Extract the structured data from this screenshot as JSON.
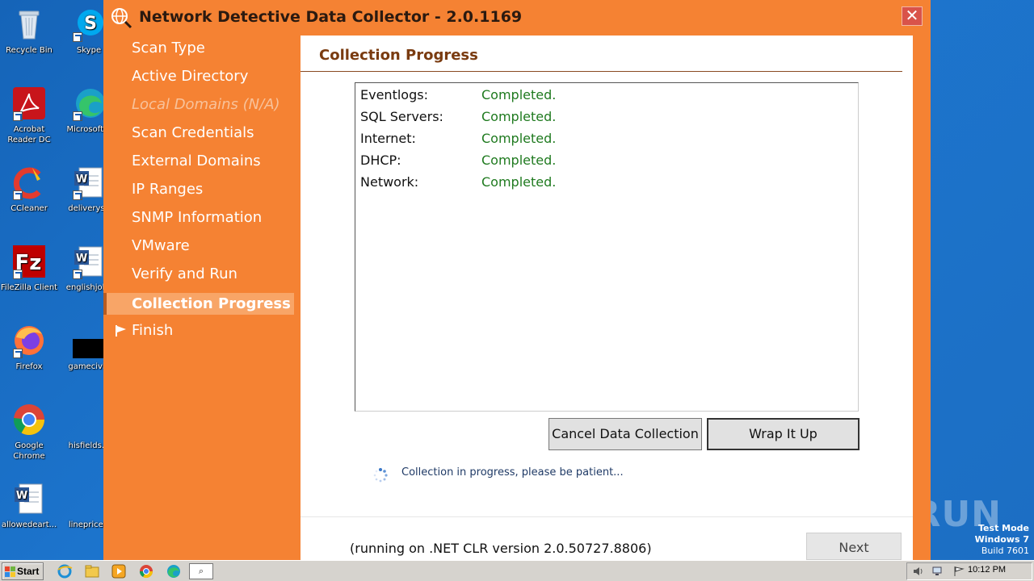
{
  "desktop": {
    "icons": [
      {
        "label": "Recycle Bin"
      },
      {
        "label": "Skype"
      },
      {
        "label": "Acrobat Reader DC"
      },
      {
        "label": "Microsoft E"
      },
      {
        "label": "CCleaner"
      },
      {
        "label": "deliveryse"
      },
      {
        "label": "FileZilla Client"
      },
      {
        "label": "englishjobs"
      },
      {
        "label": "Firefox"
      },
      {
        "label": "gamecivil."
      },
      {
        "label": "Google Chrome"
      },
      {
        "label": "hisfields.p"
      },
      {
        "label": "allowedeart..."
      },
      {
        "label": "lineprice.r"
      }
    ],
    "watermark": "ANY.RUN",
    "test_mode": {
      "line1": "Test Mode",
      "line2": "Windows 7",
      "line3": "Build 7601"
    }
  },
  "window": {
    "title": "Network Detective Data Collector - 2.0.1169",
    "close_glyph": "✕"
  },
  "nav": {
    "items": [
      {
        "label": "Scan Type",
        "state": "normal"
      },
      {
        "label": "Active Directory",
        "state": "normal"
      },
      {
        "label": "Local Domains (N/A)",
        "state": "disabled"
      },
      {
        "label": "Scan Credentials",
        "state": "normal"
      },
      {
        "label": "External Domains",
        "state": "normal"
      },
      {
        "label": "IP Ranges",
        "state": "normal"
      },
      {
        "label": "SNMP Information",
        "state": "normal"
      },
      {
        "label": "VMware",
        "state": "normal"
      },
      {
        "label": "Verify and Run",
        "state": "normal"
      },
      {
        "label": "Collection Progress",
        "state": "active"
      },
      {
        "label": "Finish",
        "state": "normal",
        "icon": "flag-icon"
      }
    ]
  },
  "main": {
    "title": "Collection Progress",
    "status": [
      {
        "name": "Eventlogs:",
        "value": "Completed."
      },
      {
        "name": "SQL Servers:",
        "value": "Completed."
      },
      {
        "name": "Internet:",
        "value": "Completed."
      },
      {
        "name": "DHCP:",
        "value": "Completed."
      },
      {
        "name": "Network:",
        "value": "Completed."
      }
    ],
    "cancel_label": "Cancel Data Collection",
    "wrap_label": "Wrap It Up",
    "progress_message": "Collection in progress, please be patient...",
    "footer_text": "(running on .NET CLR version 2.0.50727.8806)",
    "next_label": "Next"
  },
  "taskbar": {
    "start_label": "Start",
    "search_glyph": "⌕",
    "clock": "10:12 PM"
  },
  "colors": {
    "window_orange": "#f58233",
    "active_nav": "#f8a567",
    "title_brown": "#7a3b10",
    "completed_green": "#1f7a1f"
  }
}
